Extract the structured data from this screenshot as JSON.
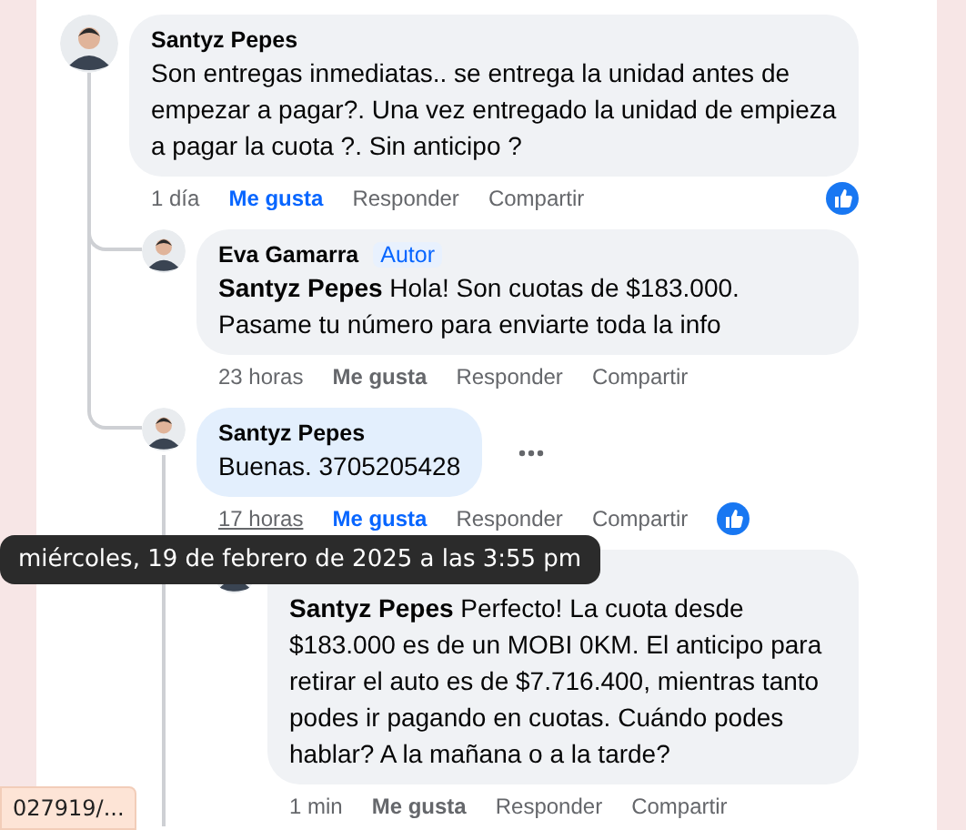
{
  "comments": [
    {
      "author": "Santyz Pepes",
      "text": "Son entregas inmediatas.. se entrega la unidad antes de empezar a pagar?. Una vez entregado la unidad de empieza a pagar la cuota ?. Sin anticipo ?",
      "time": "1 día",
      "like": "Me gusta",
      "reply": "Responder",
      "share": "Compartir",
      "liked": true,
      "hovered": false,
      "children": [
        {
          "author": "Eva Gamarra",
          "badge": "Autor",
          "text": "**Santyz Pepes** Hola! Son cuotas de $183.000. Pasame tu número para enviarte toda la info",
          "time": "23 horas",
          "like": "Me gusta",
          "reply": "Responder",
          "share": "Compartir",
          "liked": false,
          "hovered": false
        },
        {
          "author": "Santyz Pepes",
          "text": "Buenas. 3705205428",
          "time": "17 horas",
          "like": "Me gusta",
          "reply": "Responder",
          "share": "Compartir",
          "liked": true,
          "hovered": true,
          "children": [
            {
              "text": "**Santyz Pepes** Perfecto! La cuota desde $183.000 es de un MOBI 0KM. El anticipo para retirar el auto es de $7.716.400, mientras tanto podes ir pagando en cuotas. Cuándo podes hablar? A la mañana o a la tarde?",
              "time": "1 min",
              "like": "Me gusta",
              "reply": "Responder",
              "share": "Compartir",
              "liked": false,
              "hovered": false
            }
          ]
        }
      ]
    }
  ],
  "tooltip": "miércoles, 19 de febrero de 2025 a las 3:55 pm",
  "status_url": "027919/..."
}
